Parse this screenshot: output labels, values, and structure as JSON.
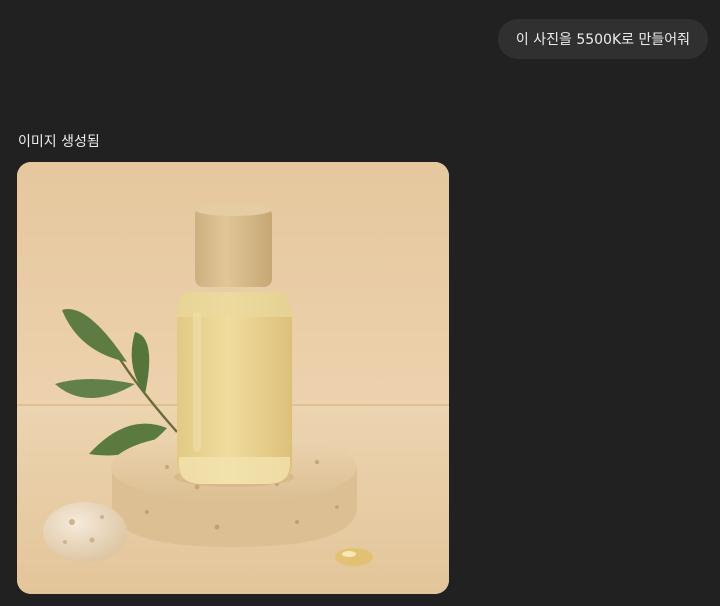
{
  "conversation": {
    "user_message": "이 사진을 5500K로 만들어줘",
    "status_label": "이미지 생성됨",
    "image": {
      "subject": "product-bottle-photo",
      "colors": {
        "backdrop": "#e8cca6",
        "surface": "#e6c9a0",
        "bottle_liquid": "#e7d08a",
        "cap": "#d5b686",
        "leaf": "#5a7a40",
        "stone": "#ead6b6"
      }
    }
  }
}
